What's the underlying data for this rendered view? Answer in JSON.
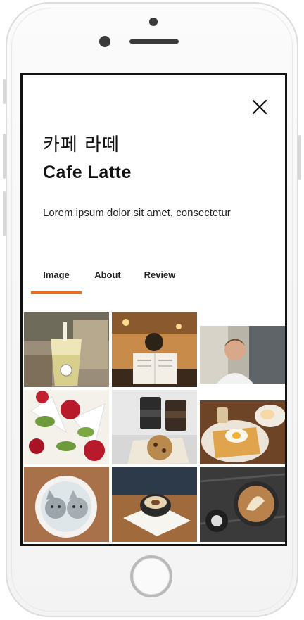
{
  "header": {
    "close_icon": "close-icon",
    "title_korean": "카페 라떼",
    "title_english": "Cafe Latte",
    "description": "Lorem ipsum dolor sit amet, consectetur"
  },
  "tabs": [
    {
      "label": "Image",
      "active": true
    },
    {
      "label": "About",
      "active": false
    },
    {
      "label": "Review",
      "active": false
    }
  ],
  "colors": {
    "accent": "#f26b1d",
    "text": "#111111",
    "frame": "#111111"
  },
  "gallery": [
    {
      "subject": "iced drink cup"
    },
    {
      "subject": "person holding menu"
    },
    {
      "subject": "woman smiling"
    },
    {
      "subject": "roses"
    },
    {
      "subject": "coffee cups and cookie"
    },
    {
      "subject": "toast with egg"
    },
    {
      "subject": "latte art cats"
    },
    {
      "subject": "latte on napkin"
    },
    {
      "subject": "latte art swan"
    }
  ]
}
